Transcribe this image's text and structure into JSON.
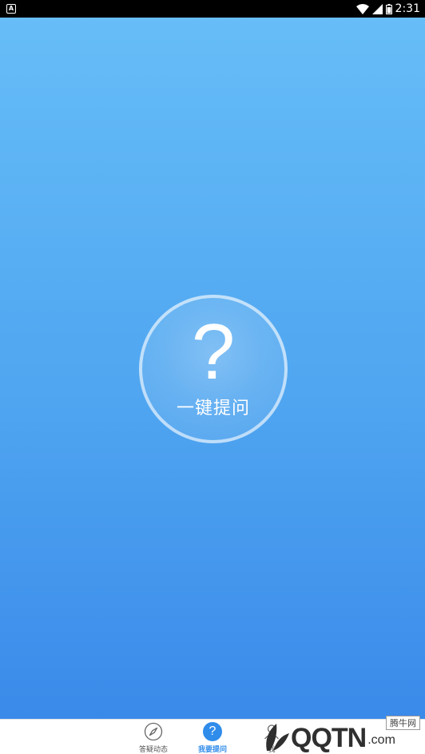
{
  "status_bar": {
    "notification_badge": "A",
    "time": "2:31"
  },
  "ask": {
    "symbol": "?",
    "label": "一键提问"
  },
  "tabs": [
    {
      "label": "答疑动态",
      "icon": "compass-icon",
      "active": false
    },
    {
      "label": "我要提问",
      "icon": "question-icon",
      "active": true
    },
    {
      "label": "我",
      "icon": "user-icon",
      "active": false
    }
  ],
  "watermark": {
    "logo": "QQTN",
    "domain": ".com",
    "badge": "腾牛网"
  },
  "colors": {
    "accent": "#2f8cea",
    "gradient_top": "#66bdf7",
    "gradient_bottom": "#3a8aea"
  }
}
